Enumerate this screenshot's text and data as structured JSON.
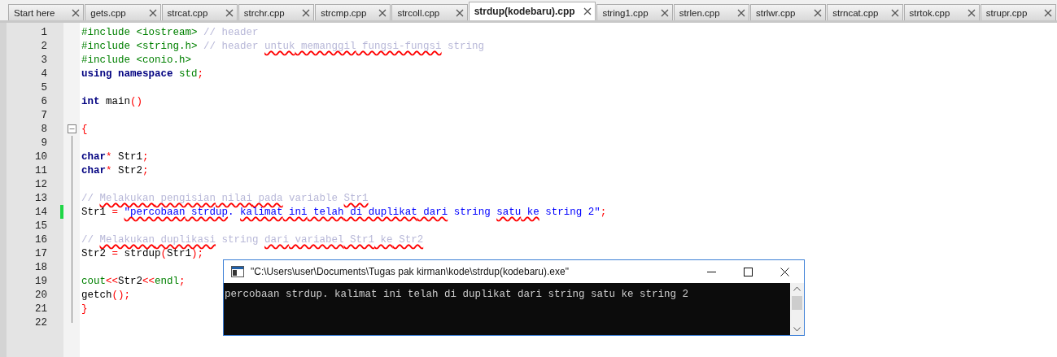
{
  "tabs": [
    {
      "label": "Start here",
      "selected": false
    },
    {
      "label": "gets.cpp",
      "selected": false
    },
    {
      "label": "strcat.cpp",
      "selected": false
    },
    {
      "label": "strchr.cpp",
      "selected": false
    },
    {
      "label": "strcmp.cpp",
      "selected": false
    },
    {
      "label": "strcoll.cpp",
      "selected": false
    },
    {
      "label": "strdup(kodebaru).cpp",
      "selected": true
    },
    {
      "label": "string1.cpp",
      "selected": false
    },
    {
      "label": "strlen.cpp",
      "selected": false
    },
    {
      "label": "strlwr.cpp",
      "selected": false
    },
    {
      "label": "strncat.cpp",
      "selected": false
    },
    {
      "label": "strtok.cpp",
      "selected": false
    },
    {
      "label": "strupr.cpp",
      "selected": false
    }
  ],
  "editor": {
    "lines": [
      {
        "number": "1",
        "changed": false,
        "kind": "plain",
        "tokens": [
          {
            "t": "#include <iostream> ",
            "kind": "pre",
            "sq": false
          },
          {
            "t": "// header",
            "kind": "cmt",
            "sq": false
          }
        ]
      },
      {
        "number": "2",
        "changed": false,
        "kind": "plain",
        "tokens": [
          {
            "t": "#include <string.h> ",
            "kind": "pre",
            "sq": false
          },
          {
            "t": "// header ",
            "kind": "cmt",
            "sq": false
          },
          {
            "t": "untuk",
            "kind": "cmt",
            "sq": true
          },
          {
            "t": " memanggil",
            "kind": "cmt",
            "sq": true
          },
          {
            "t": " fungsi-fungsi",
            "kind": "cmt",
            "sq": true
          },
          {
            "t": " string",
            "kind": "cmt",
            "sq": false
          }
        ]
      },
      {
        "number": "3",
        "changed": false,
        "kind": "plain",
        "tokens": [
          {
            "t": "#include <conio.h>",
            "kind": "pre",
            "sq": false
          }
        ]
      },
      {
        "number": "4",
        "changed": false,
        "kind": "plain",
        "tokens": [
          {
            "t": "using namespace ",
            "kind": "kw",
            "sq": false
          },
          {
            "t": "std",
            "kind": "lib",
            "sq": false
          },
          {
            "t": ";",
            "kind": "op",
            "sq": false
          }
        ]
      },
      {
        "number": "5",
        "changed": false,
        "kind": "plain"
      },
      {
        "number": "6",
        "changed": false,
        "kind": "plain",
        "tokens": [
          {
            "t": "int",
            "kind": "kw",
            "sq": false
          },
          {
            "t": " main",
            "kind": "id",
            "sq": false
          },
          {
            "t": "()",
            "kind": "op",
            "sq": false
          }
        ]
      },
      {
        "number": "7",
        "changed": false,
        "kind": "plain"
      },
      {
        "number": "8",
        "changed": false,
        "kind": "fold-start",
        "tokens": [
          {
            "t": "{",
            "kind": "op",
            "sq": false
          }
        ]
      },
      {
        "number": "9",
        "changed": false,
        "kind": "fold-body"
      },
      {
        "number": "10",
        "changed": false,
        "kind": "fold-body",
        "tokens": [
          {
            "t": "char",
            "kind": "kw",
            "sq": false
          },
          {
            "t": "*",
            "kind": "op",
            "sq": false
          },
          {
            "t": " Str1",
            "kind": "id",
            "sq": false
          },
          {
            "t": ";",
            "kind": "op",
            "sq": false
          }
        ]
      },
      {
        "number": "11",
        "changed": false,
        "kind": "fold-body",
        "tokens": [
          {
            "t": "char",
            "kind": "kw",
            "sq": false
          },
          {
            "t": "*",
            "kind": "op",
            "sq": false
          },
          {
            "t": " Str2",
            "kind": "id",
            "sq": false
          },
          {
            "t": ";",
            "kind": "op",
            "sq": false
          }
        ]
      },
      {
        "number": "12",
        "changed": false,
        "kind": "fold-body"
      },
      {
        "number": "13",
        "changed": false,
        "kind": "fold-body",
        "tokens": [
          {
            "t": "// ",
            "kind": "cmt",
            "sq": false
          },
          {
            "t": "Melakukan",
            "kind": "cmt",
            "sq": true
          },
          {
            "t": " pengisian",
            "kind": "cmt",
            "sq": true
          },
          {
            "t": " nilai",
            "kind": "cmt",
            "sq": true
          },
          {
            "t": " pada",
            "kind": "cmt",
            "sq": true
          },
          {
            "t": " variable ",
            "kind": "cmt",
            "sq": false
          },
          {
            "t": "Str1",
            "kind": "cmt",
            "sq": true
          }
        ]
      },
      {
        "number": "14",
        "changed": true,
        "kind": "fold-body",
        "tokens": [
          {
            "t": "Str1 ",
            "kind": "id",
            "sq": false
          },
          {
            "t": "= ",
            "kind": "op",
            "sq": false
          },
          {
            "t": "\"percobaan",
            "kind": "str",
            "sq": true
          },
          {
            "t": " strdup",
            "kind": "str",
            "sq": true
          },
          {
            "t": ". ",
            "kind": "str",
            "sq": false
          },
          {
            "t": "kalimat",
            "kind": "str",
            "sq": true
          },
          {
            "t": " ini",
            "kind": "str",
            "sq": true
          },
          {
            "t": " telah",
            "kind": "str",
            "sq": true
          },
          {
            "t": " di",
            "kind": "str",
            "sq": true
          },
          {
            "t": " duplikat",
            "kind": "str",
            "sq": true
          },
          {
            "t": " dari",
            "kind": "str",
            "sq": true
          },
          {
            "t": " string ",
            "kind": "str",
            "sq": false
          },
          {
            "t": "satu",
            "kind": "str",
            "sq": true
          },
          {
            "t": " ke",
            "kind": "str",
            "sq": true
          },
          {
            "t": " string 2\"",
            "kind": "str",
            "sq": false
          },
          {
            "t": ";",
            "kind": "op",
            "sq": false
          }
        ]
      },
      {
        "number": "15",
        "changed": false,
        "kind": "fold-body"
      },
      {
        "number": "16",
        "changed": false,
        "kind": "fold-body",
        "tokens": [
          {
            "t": "// ",
            "kind": "cmt",
            "sq": false
          },
          {
            "t": "Melakukan",
            "kind": "cmt",
            "sq": true
          },
          {
            "t": " duplikasi",
            "kind": "cmt",
            "sq": true
          },
          {
            "t": " string ",
            "kind": "cmt",
            "sq": false
          },
          {
            "t": "dari",
            "kind": "cmt",
            "sq": true
          },
          {
            "t": " variabel",
            "kind": "cmt",
            "sq": true
          },
          {
            "t": " Str1",
            "kind": "cmt",
            "sq": true
          },
          {
            "t": " ke",
            "kind": "cmt",
            "sq": true
          },
          {
            "t": " Str2",
            "kind": "cmt",
            "sq": true
          }
        ]
      },
      {
        "number": "17",
        "changed": false,
        "kind": "fold-body",
        "tokens": [
          {
            "t": "Str2 ",
            "kind": "id",
            "sq": false
          },
          {
            "t": "= ",
            "kind": "op",
            "sq": false
          },
          {
            "t": "strdup",
            "kind": "id",
            "sq": false
          },
          {
            "t": "(",
            "kind": "op",
            "sq": false
          },
          {
            "t": "Str1",
            "kind": "id",
            "sq": false
          },
          {
            "t": ");",
            "kind": "op",
            "sq": false
          }
        ]
      },
      {
        "number": "18",
        "changed": false,
        "kind": "fold-body"
      },
      {
        "number": "19",
        "changed": false,
        "kind": "fold-body",
        "tokens": [
          {
            "t": "cout",
            "kind": "lib",
            "sq": false
          },
          {
            "t": "<<",
            "kind": "op",
            "sq": false
          },
          {
            "t": "Str2",
            "kind": "id",
            "sq": false
          },
          {
            "t": "<<",
            "kind": "op",
            "sq": false
          },
          {
            "t": "endl",
            "kind": "lib",
            "sq": false
          },
          {
            "t": ";",
            "kind": "op",
            "sq": false
          }
        ]
      },
      {
        "number": "20",
        "changed": false,
        "kind": "fold-body",
        "tokens": [
          {
            "t": "getch",
            "kind": "id",
            "sq": false
          },
          {
            "t": "();",
            "kind": "op",
            "sq": false
          }
        ]
      },
      {
        "number": "21",
        "changed": false,
        "kind": "fold-body",
        "tokens": [
          {
            "t": "}",
            "kind": "op",
            "sq": false
          }
        ]
      },
      {
        "number": "22",
        "changed": false,
        "kind": "fold-end"
      }
    ]
  },
  "console": {
    "title": "\"C:\\Users\\user\\Documents\\Tugas pak kirman\\kode\\strdup(kodebaru).exe\"",
    "output": "percobaan strdup. kalimat ini telah di duplikat dari string satu ke string 2"
  }
}
